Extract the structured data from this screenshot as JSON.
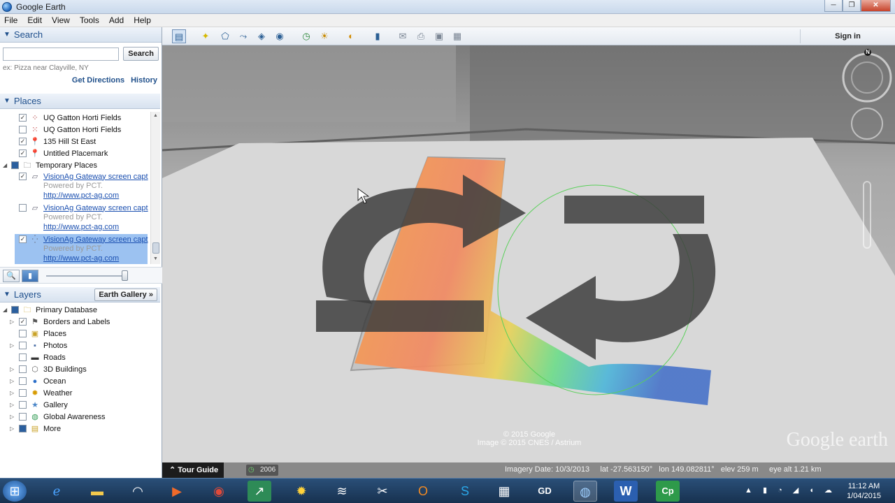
{
  "app": {
    "title": "Google Earth",
    "window_buttons": [
      "─",
      "❐",
      "✕"
    ]
  },
  "menu": [
    "File",
    "Edit",
    "View",
    "Tools",
    "Add",
    "Help"
  ],
  "search": {
    "header": "Search",
    "placeholder": "",
    "value": "",
    "button_label": "Search",
    "hint": "ex: Pizza near Clayville, NY",
    "get_directions": "Get Directions",
    "history": "History"
  },
  "places": {
    "header": "Places",
    "items": [
      {
        "label": "UQ Gatton Horti Fields",
        "checked": true,
        "icon": "path-icon"
      },
      {
        "label": "UQ Gatton Horti Fields",
        "checked": false,
        "icon": "path-icon"
      },
      {
        "label": "135 Hill St East",
        "checked": true,
        "icon": "placemark-icon"
      },
      {
        "label": "Untitled Placemark",
        "checked": true,
        "icon": "placemark-icon"
      }
    ],
    "temporary_label": "Temporary Places",
    "overlays": [
      {
        "title": "VisionAg Gateway screen capt",
        "powered": "Powered by PCT.",
        "url": "http://www.pct-ag.com",
        "checked": true
      },
      {
        "title": "VisionAg Gateway screen capt",
        "powered": "Powered by PCT.",
        "url": "http://www.pct-ag.com",
        "checked": false
      },
      {
        "title": "VisionAg Gateway screen capt",
        "powered": "Powered by PCT.",
        "url": "http://www.pct-ag.com",
        "checked": true
      }
    ]
  },
  "layers": {
    "header": "Layers",
    "gallery_button": "Earth Gallery",
    "primary": "Primary Database",
    "items": [
      {
        "label": "Borders and Labels",
        "checked": true
      },
      {
        "label": "Places",
        "checked": false
      },
      {
        "label": "Photos",
        "checked": false
      },
      {
        "label": "Roads",
        "checked": false
      },
      {
        "label": "3D Buildings",
        "checked": false
      },
      {
        "label": "Ocean",
        "checked": false
      },
      {
        "label": "Weather",
        "checked": false
      },
      {
        "label": "Gallery",
        "checked": false
      },
      {
        "label": "Global Awareness",
        "checked": false
      },
      {
        "label": "More",
        "checked": false
      }
    ]
  },
  "toolbar": {
    "sign_in": "Sign in"
  },
  "map": {
    "copyright_line1": "© 2015 Google",
    "copyright_line2": "Image © 2015 CNES / Astrium",
    "logo": "Google earth",
    "compass_n": "N"
  },
  "status": {
    "tour_guide": "Tour Guide",
    "year": "2006",
    "imagery_date": "Imagery Date: 10/3/2013",
    "lat": "lat  -27.563150°",
    "lon": "lon  149.082811°",
    "elev": "elev   259 m",
    "eye_alt": "eye alt   1.21 km"
  },
  "taskbar": {
    "time": "11:12 AM",
    "date": "1/04/2015",
    "tray_arrow": "▲"
  }
}
